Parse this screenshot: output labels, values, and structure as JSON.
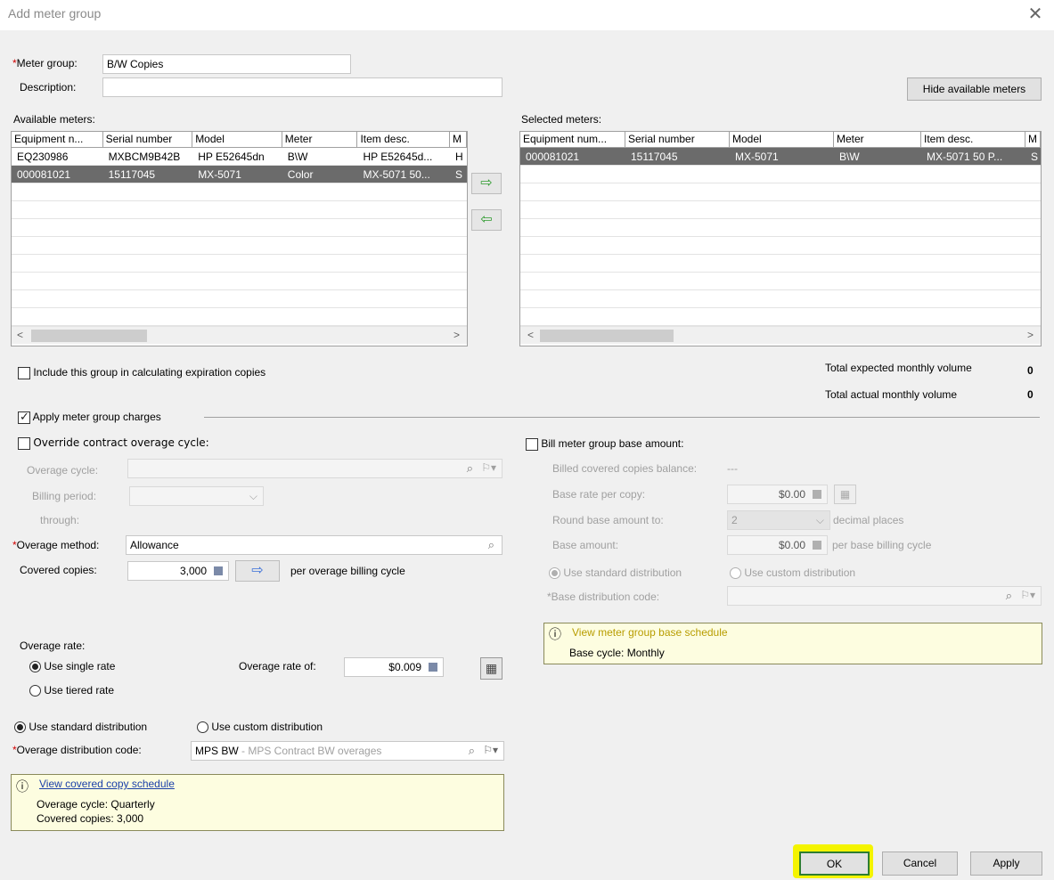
{
  "window": {
    "title": "Add meter group",
    "close": "✕"
  },
  "meter_group": {
    "label": "Meter group:",
    "value": "B/W Copies"
  },
  "description": {
    "label": "Description:",
    "value": ""
  },
  "hide_meters_button": "Hide available meters",
  "available": {
    "label": "Available meters:",
    "columns": [
      "Equipment n...",
      "Serial number",
      "Model",
      "Meter",
      "Item desc.",
      "M"
    ],
    "rows": [
      [
        "EQ230986",
        "MXBCM9B42B",
        "HP E52645dn",
        "B\\W",
        "HP E52645d...",
        "H"
      ],
      [
        "000081021",
        "15117045",
        "MX-5071",
        "Color",
        "MX-5071 50...",
        "S"
      ]
    ]
  },
  "selected": {
    "label": "Selected meters:",
    "columns": [
      "Equipment num...",
      "Serial number",
      "Model",
      "Meter",
      "Item desc.",
      "M"
    ],
    "rows": [
      [
        "000081021",
        "15117045",
        "MX-5071",
        "B\\W",
        "MX-5071 50 P...",
        "S"
      ]
    ]
  },
  "move_right": "⇨",
  "move_left": "⇦",
  "include_group": "Include this group in calculating expiration copies",
  "totals": {
    "expected_label": "Total expected monthly volume",
    "expected_value": "0",
    "actual_label": "Total actual monthly volume",
    "actual_value": "0"
  },
  "apply_charges": "Apply meter group charges",
  "override_cycle": "Override contract overage cycle:",
  "overage_cycle_label": "Overage cycle:",
  "billing_period_label": "Billing period:",
  "through_label": "through:",
  "overage_method": {
    "label": "Overage method:",
    "value": "Allowance"
  },
  "covered_copies": {
    "label": "Covered copies:",
    "value": "3,000",
    "suffix": "per overage billing cycle"
  },
  "overage_rate": {
    "label": "Overage rate:",
    "single": "Use single rate",
    "tiered": "Use tiered rate",
    "rate_label": "Overage rate of:",
    "rate_value": "$0.009"
  },
  "distribution": {
    "standard": "Use standard distribution",
    "custom": "Use custom distribution",
    "code_label": "Overage distribution code:",
    "code_value": "MPS BW",
    "code_desc": " - MPS Contract BW overages"
  },
  "copy_schedule": {
    "link": "View covered copy schedule",
    "cycle": "Overage cycle: Quarterly",
    "copies": "Covered copies: 3,000"
  },
  "base": {
    "checkbox": "Bill meter group base amount:",
    "balance_label": "Billed covered copies balance:",
    "balance_value": "---",
    "rate_label": "Base rate per copy:",
    "rate_value": "$0.00",
    "round_label": "Round base amount to:",
    "round_value": "2",
    "round_suffix": "decimal places",
    "amount_label": "Base amount:",
    "amount_value": "$0.00",
    "amount_suffix": "per base billing cycle",
    "std_dist": "Use standard distribution",
    "custom_dist": "Use custom distribution",
    "dist_code_label": "*Base distribution code:",
    "schedule_link": "View meter group base schedule",
    "schedule_cycle": "Base cycle: Monthly"
  },
  "footer": {
    "ok": "OK",
    "cancel": "Cancel",
    "apply": "Apply"
  },
  "colors": {
    "highlight": "#f4f400",
    "required": "#d00000",
    "selected_row": "#6b6b6b"
  }
}
